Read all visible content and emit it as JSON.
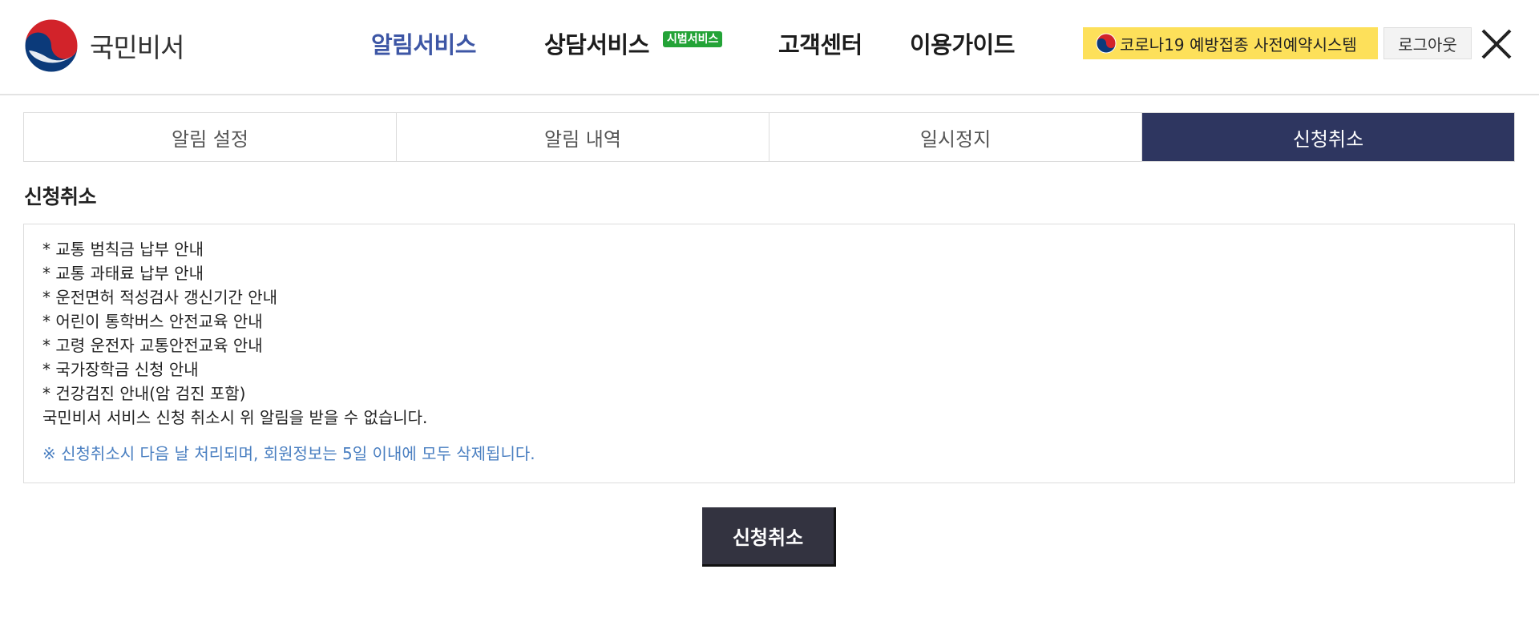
{
  "header": {
    "logo_text": "국민비서",
    "nav": [
      {
        "label": "알림서비스",
        "active": true
      },
      {
        "label": "상담서비스",
        "badge": "시범서비스"
      },
      {
        "label": "고객센터"
      },
      {
        "label": "이용가이드"
      }
    ],
    "covid_button": "코로나19 예방접종 사전예약시스템",
    "logout_button": "로그아웃",
    "close_icon": "close-icon"
  },
  "tabs": [
    {
      "label": "알림 설정"
    },
    {
      "label": "알림 내역"
    },
    {
      "label": "일시정지"
    },
    {
      "label": "신청취소",
      "active": true
    }
  ],
  "section": {
    "title": "신청취소",
    "items": [
      "* 교통 범칙금 납부 안내",
      "* 교통 과태료 납부 안내",
      "* 운전면허 적성검사 갱신기간 안내",
      "* 어린이 통학버스 안전교육 안내",
      "* 고령 운전자 교통안전교육 안내",
      "* 국가장학금 신청 안내",
      "* 건강검진 안내(암 검진 포함)"
    ],
    "summary": "국민비서 서비스 신청 취소시 위 알림을 받을 수 없습니다.",
    "note": "※ 신청취소시 다음 날 처리되며, 회원정보는 5일 이내에 모두 삭제됩니다."
  },
  "submit_button": "신청취소",
  "colors": {
    "nav_active": "#3d56a5",
    "tab_active_bg": "#2e3660",
    "covid_bg": "#fde05a",
    "badge_bg": "#23a337",
    "note_text": "#4a7fc1",
    "submit_bg": "#333340"
  }
}
